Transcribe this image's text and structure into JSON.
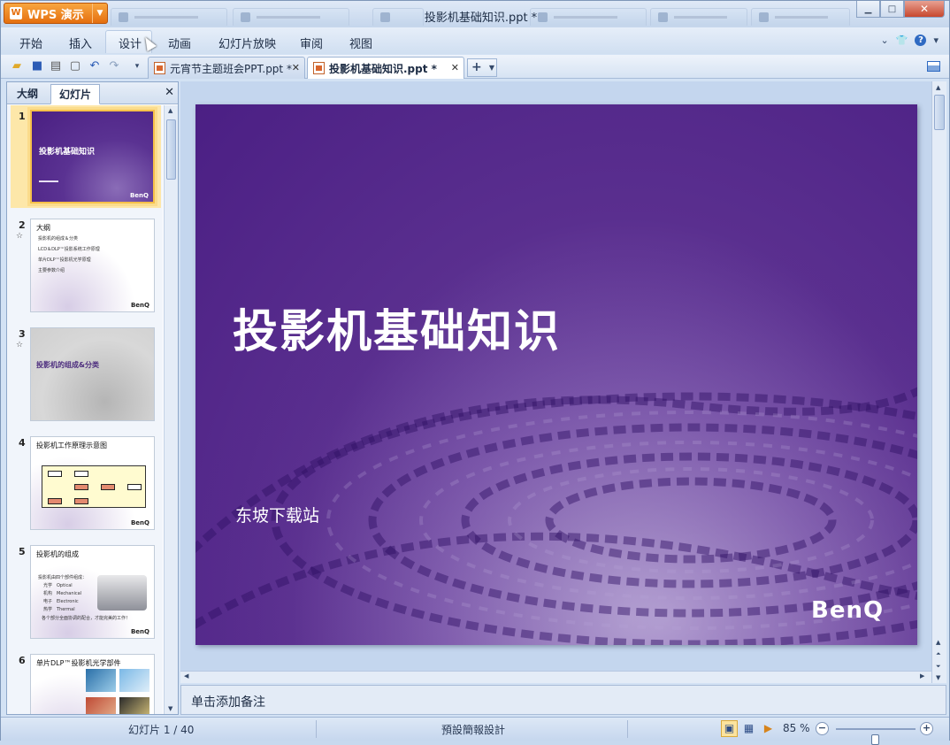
{
  "app": {
    "name": "WPS 演示",
    "title": "投影机基础知识.ppt *",
    "logo_glyph": "W"
  },
  "window": {
    "minimize_glyph": "▁",
    "maximize_glyph": "□",
    "close_glyph": "✕"
  },
  "menu": {
    "tabs": [
      "开始",
      "插入",
      "设计",
      "动画",
      "幻灯片放映",
      "审阅",
      "视图"
    ],
    "active": "设计"
  },
  "doc_tabs": [
    {
      "label": "元宵节主题班会PPT.ppt *",
      "active": false
    },
    {
      "label": "投影机基础知识.ppt *",
      "active": true
    }
  ],
  "left_panel": {
    "tabs": [
      "大纲",
      "幻灯片"
    ],
    "active_tab": "幻灯片",
    "thumbnails": [
      {
        "number": "1",
        "title": "投影机基础知识",
        "star": false,
        "selected": true
      },
      {
        "number": "2",
        "title": "大纲",
        "star": true,
        "items": [
          "投影机的组成＆分类",
          "LCD＆DLP™投影系统工作原理",
          "单片DLP™投影机光学原理",
          "主要参数介绍"
        ]
      },
      {
        "number": "3",
        "title": "投影机的组成&分类",
        "star": true
      },
      {
        "number": "4",
        "title": "投影机工作原理示意图",
        "star": false
      },
      {
        "number": "5",
        "title": "投影机的组成",
        "star": false,
        "items": [
          "投影机由四个部件组成：",
          "光学　Optical",
          "机构　Mechanical",
          "电子　Electronic",
          "热学　Thermal",
          "各个部分全面协调的配合，才能完美的工作！"
        ]
      },
      {
        "number": "6",
        "title": "单片DLP™投影机光学部件",
        "star": false
      }
    ],
    "brand_small": "BenQ"
  },
  "slide": {
    "title": "投影机基础知识",
    "subtitle": "东坡下载站",
    "logo": "BenQ",
    "bg_color": "#4b1f84"
  },
  "notes": {
    "placeholder": "单击添加备注"
  },
  "status": {
    "slide_counter": "幻灯片 1 / 40",
    "theme": "預設簡報設計",
    "zoom": "85 %",
    "zoom_value": 0.5
  },
  "colors": {
    "accent": "#e56f0f",
    "slide_purple": "#4b1f84",
    "ribbon": "#d0dff1"
  }
}
